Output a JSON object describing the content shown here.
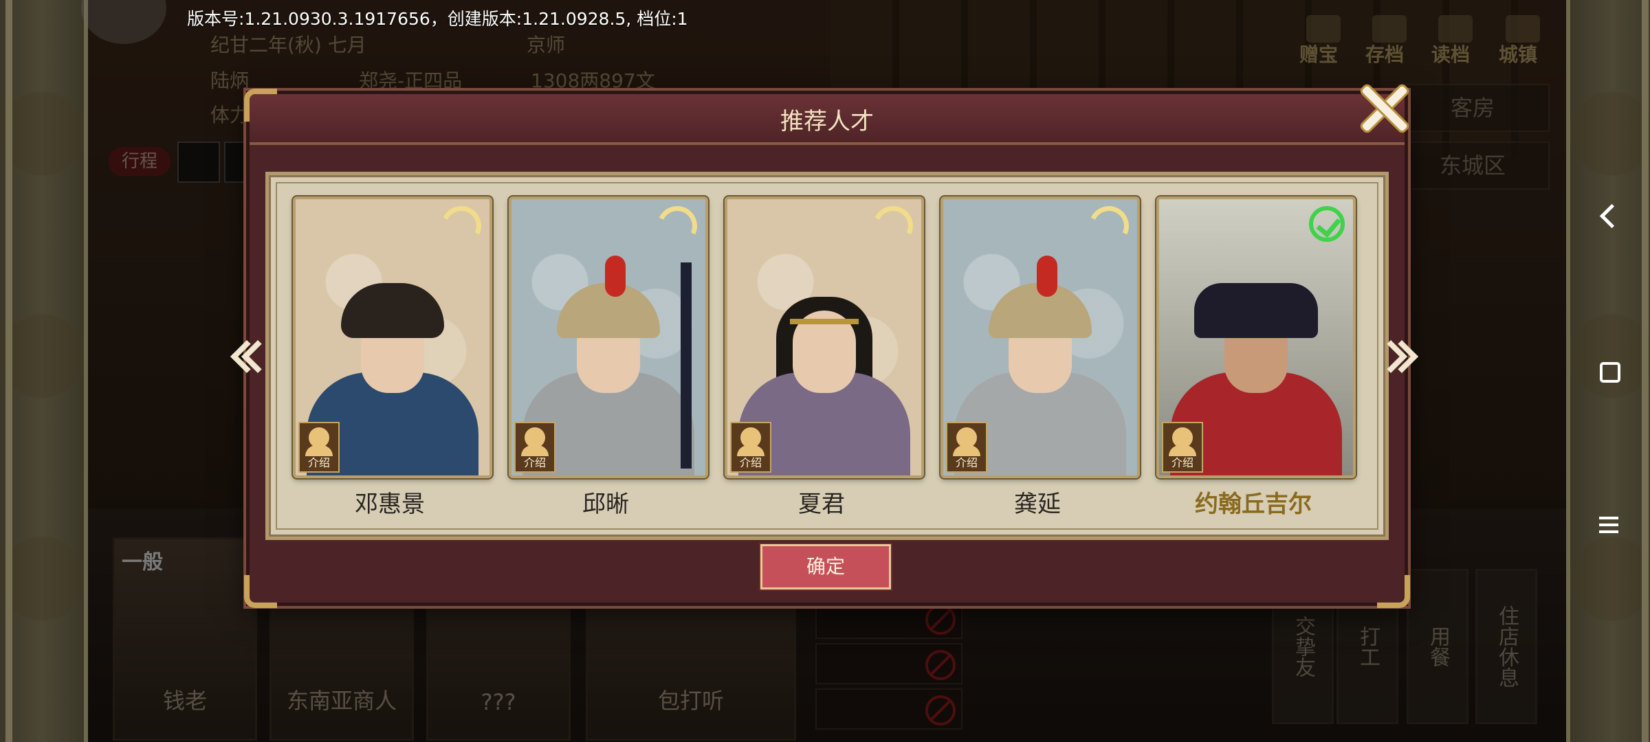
{
  "version_text": "版本号:1.21.0930.3.1917656，创建版本:1.21.0928.5, 档位:1",
  "hud": {
    "date": "纪甘二年(秋) 七月",
    "location": "京师",
    "player_name": "陆炳",
    "rank": "郑尧-正四品",
    "money": "1308两897文",
    "stamina_label": "体力",
    "route_label": "行程",
    "top_menu": [
      "赠宝",
      "存档",
      "读档",
      "城镇"
    ],
    "places": [
      "客房",
      "东城区"
    ]
  },
  "npcs": [
    {
      "name": "钱老",
      "mood": "一般"
    },
    {
      "name": "东南亚商人"
    },
    {
      "name": "???"
    },
    {
      "name": "包打听"
    }
  ],
  "side_actions": [
    "交挚友",
    "打工",
    "用餐",
    "住店休息"
  ],
  "dialog": {
    "title": "推荐人才",
    "confirm_label": "确定",
    "intro_label": "介绍",
    "candidates": [
      {
        "name": "邓惠景",
        "status": "pending",
        "bg": "beige"
      },
      {
        "name": "邱晰",
        "status": "pending",
        "bg": "blue"
      },
      {
        "name": "夏君",
        "status": "pending",
        "bg": "beige"
      },
      {
        "name": "龚延",
        "status": "pending",
        "bg": "blue"
      },
      {
        "name": "约翰丘吉尔",
        "status": "selected",
        "bg": "photo"
      }
    ]
  },
  "colors": {
    "dialog_bg": "#4c2428",
    "panel_bg": "#d6cdb4",
    "confirm_btn": "#c6505a",
    "selected_check": "#3fd24a",
    "pending_ring": "#f1dc8a"
  }
}
